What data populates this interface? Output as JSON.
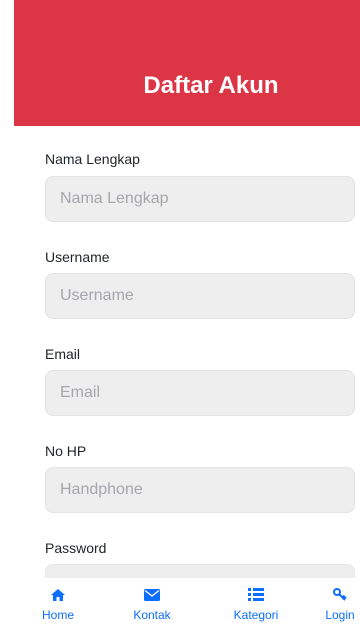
{
  "header": {
    "title": "Daftar Akun"
  },
  "form": {
    "fields": [
      {
        "label": "Nama Lengkap",
        "placeholder": "Nama Lengkap"
      },
      {
        "label": "Username",
        "placeholder": "Username"
      },
      {
        "label": "Email",
        "placeholder": "Email"
      },
      {
        "label": "No HP",
        "placeholder": "Handphone"
      },
      {
        "label": "Password",
        "placeholder": ""
      }
    ]
  },
  "nav": {
    "items": [
      {
        "label": "Home",
        "icon": "home-icon"
      },
      {
        "label": "Kontak",
        "icon": "envelope-icon"
      },
      {
        "label": "Kategori",
        "icon": "list-icon"
      },
      {
        "label": "Login",
        "icon": "key-icon"
      }
    ]
  },
  "colors": {
    "accent": "#dc3545",
    "nav": "#0d6efd",
    "input_bg": "#eeeeef"
  }
}
